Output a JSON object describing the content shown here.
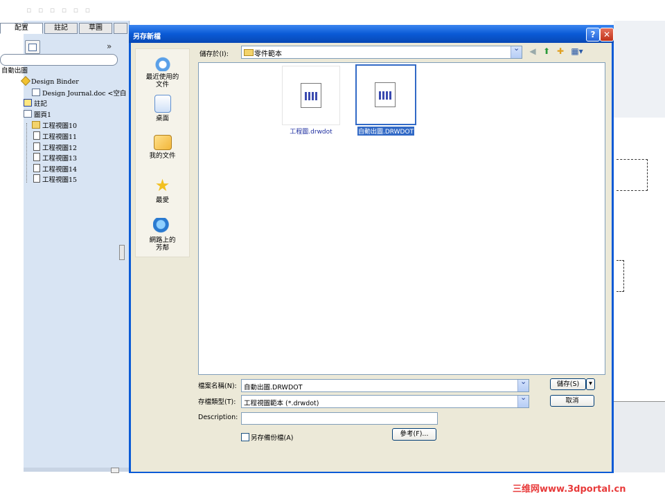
{
  "background_app": {
    "tabs": [
      "配置",
      "註記",
      "草圖"
    ],
    "tree": [
      {
        "label": "自動出圖",
        "icon": "none"
      },
      {
        "label": "Design Binder",
        "icon": "diamond"
      },
      {
        "label": "Design Journal.doc <空白",
        "icon": "note"
      },
      {
        "label": "註記",
        "icon": "note"
      },
      {
        "label": "圖頁1",
        "icon": "sheet"
      },
      {
        "label": "工程視圖10",
        "icon": "folder"
      },
      {
        "label": "工程視圖11",
        "icon": "view"
      },
      {
        "label": "工程視圖12",
        "icon": "view"
      },
      {
        "label": "工程視圖13",
        "icon": "view"
      },
      {
        "label": "工程視圖14",
        "icon": "view"
      },
      {
        "label": "工程視圖15",
        "icon": "view"
      }
    ],
    "chevron": "»"
  },
  "dialog": {
    "title": "另存新檔",
    "help": "?",
    "close": "✕",
    "places": [
      {
        "label": "最近使用的文件",
        "icon": "recent-icon"
      },
      {
        "label": "桌面",
        "icon": "desktop-icon"
      },
      {
        "label": "我的文件",
        "icon": "my-documents-icon"
      },
      {
        "label": "最愛",
        "icon": "favorites-icon"
      },
      {
        "label": "網路上的芳鄰",
        "icon": "network-icon"
      }
    ],
    "lookin_label": "儲存於(I):",
    "lookin_value": "零件範本",
    "files": [
      {
        "name": "工程圖.drwdot",
        "selected": false
      },
      {
        "name": "自動出圖.DRWDOT",
        "selected": true
      }
    ],
    "filename_label": "檔案名稱(N):",
    "filename_value": "自動出圖.DRWDOT",
    "filetype_label": "存檔類型(T):",
    "filetype_value": "工程視圖範本 (*.drwdot)",
    "description_label": "Description:",
    "description_value": "",
    "save_button": "儲存(S)",
    "cancel_button": "取消",
    "backup_label": "另存備份檔(A)",
    "backup_checked": false,
    "reference_button": "參考(F)..."
  },
  "watermark": "三维网www.3dportal.cn"
}
